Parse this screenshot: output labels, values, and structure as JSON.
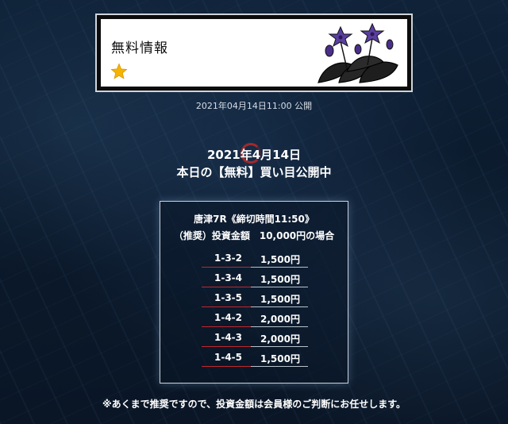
{
  "banner": {
    "title": "無料情報",
    "star_icon": "star-icon",
    "illustration": "purple-flower-illustration",
    "colors": {
      "star": "#f5b400",
      "flower": "#5a3fa0",
      "leaf": "#1a1a1a"
    }
  },
  "publish_date": "2021年04月14日11:00 公開",
  "headline": {
    "date": "2021年4月14日",
    "main": "本日の【無料】買い目公開中"
  },
  "pick_box": {
    "race": "唐津7R《締切時間11:50》",
    "bet": "（推奨）投資金額　10,000円の場合",
    "picks": [
      {
        "combo": "1-3-2",
        "amount": "1,500円"
      },
      {
        "combo": "1-3-4",
        "amount": "1,500円"
      },
      {
        "combo": "1-3-5",
        "amount": "1,500円"
      },
      {
        "combo": "1-4-2",
        "amount": "2,000円"
      },
      {
        "combo": "1-4-3",
        "amount": "2,000円"
      },
      {
        "combo": "1-4-5",
        "amount": "1,500円"
      }
    ]
  },
  "disclaimer": "※あくまで推奨ですので、投資金額は会員様のご判断にお任せします。"
}
